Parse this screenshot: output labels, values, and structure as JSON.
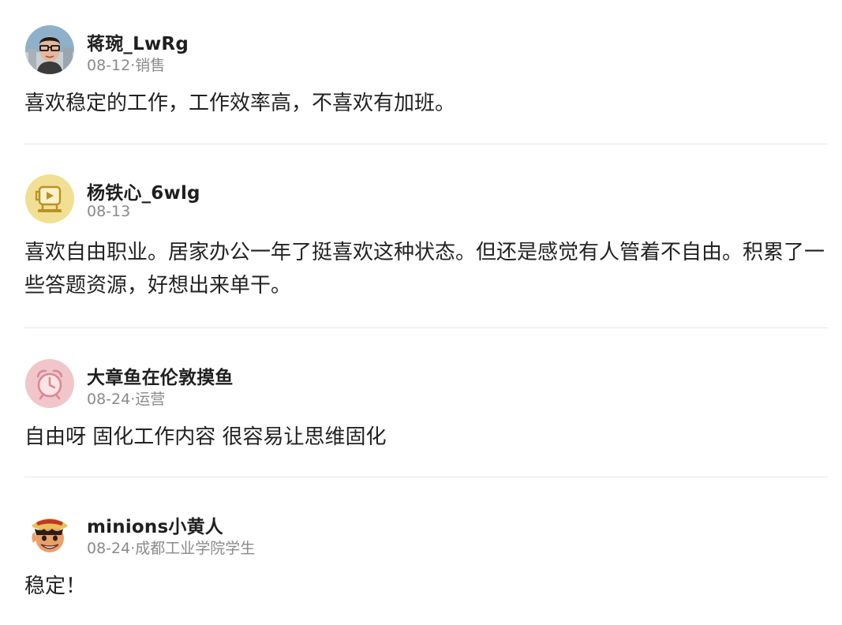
{
  "comments": [
    {
      "username": "蒋琬_LwRg",
      "meta": "08-12·销售",
      "text": "喜欢稳定的工作，工作效率高，不喜欢有加班。",
      "avatar_icon": "man-with-glasses-avatar"
    },
    {
      "username": "杨铁心_6wlg",
      "meta": "08-13",
      "text": "喜欢自由职业。居家办公一年了挺喜欢这种状态。但还是感觉有人管着不自由。积累了一些答题资源，好想出来单干。",
      "avatar_icon": "video-mascot-avatar"
    },
    {
      "username": "大章鱼在伦敦摸鱼",
      "meta": "08-24·运营",
      "text": "自由呀 固化工作内容 很容易让思维固化",
      "avatar_icon": "alarm-clock-avatar"
    },
    {
      "username": "minions小黄人",
      "meta": "08-24·成都工业学院学生",
      "text": "稳定！",
      "avatar_icon": "straw-hat-cartoon-avatar"
    }
  ],
  "colors": {
    "username": "#1f1f1f",
    "meta": "#8a8a8a",
    "body": "#222222",
    "divider": "#e6e6e6"
  }
}
